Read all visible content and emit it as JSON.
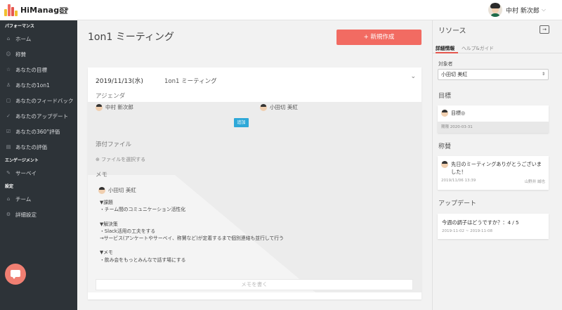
{
  "app": {
    "logo_text": "HiManager"
  },
  "user": {
    "name": "中村 新次郎"
  },
  "sidebar": {
    "sections": [
      {
        "title": "パフォーマンス",
        "items": [
          {
            "label": "ホーム",
            "icon": "home-icon"
          },
          {
            "label": "称賛",
            "icon": "smile-icon"
          },
          {
            "label": "あなたの目標",
            "icon": "star-icon"
          },
          {
            "label": "あなたの1on1",
            "icon": "person-icon"
          },
          {
            "label": "あなたのフィードバック",
            "icon": "chat-icon"
          },
          {
            "label": "あなたのアップデート",
            "icon": "check-icon"
          },
          {
            "label": "あなたの360°評価",
            "icon": "checkbox-icon"
          },
          {
            "label": "あなたの評価",
            "icon": "chart-icon"
          }
        ]
      },
      {
        "title": "エンゲージメント",
        "items": [
          {
            "label": "サーベイ",
            "icon": "edit-icon"
          }
        ]
      },
      {
        "title": "設定",
        "items": [
          {
            "label": "チーム",
            "icon": "home-icon"
          },
          {
            "label": "詳細設定",
            "icon": "gear-icon"
          }
        ]
      }
    ]
  },
  "main": {
    "title": "1on1 ミーティング",
    "new_button": "+ 新規作成",
    "meeting": {
      "date": "2019/11/13(水)",
      "name": "1on1 ミーティング",
      "agenda_label": "アジェンダ",
      "participant_a": "中村 新次郎",
      "participant_b": "小田切 美紅",
      "add_button": "追加",
      "attachments_label": "添付ファイル",
      "file_select": "ファイルを選択する",
      "memo_label": "メモ",
      "memo_author": "小田切 美紅",
      "memo_body": "▼課題\n・チーム間のコミュニケーション活性化\n\n▼解決策\n・Slack活用の工夫をする\n→サービス(アンケートやサーベイ、称賛など)が定着するまで個別連絡も並行して行う\n\n▼メモ\n・飲み会をもっとみんなで話す場にする",
      "memo_placeholder": "メモを書く"
    }
  },
  "panel": {
    "title": "リソース",
    "tabs": [
      "詳細情報",
      "ヘルプ&ガイド"
    ],
    "target_label": "対象者",
    "target_value": "小田切 美紅",
    "goal_section": "目標",
    "goal_title": "目標◎",
    "goal_due": "期限 2020-03-31",
    "praise_section": "称賛",
    "praise_text": "先日のミーティングありがとうございました！",
    "praise_date": "2019/11/06 13:39",
    "praise_by": "山野井 誠也",
    "update_section": "アップデート",
    "update_text": "今週の調子はどうですか？：4 / 5",
    "update_range": "2019-11-02 ~ 2019-11-08"
  },
  "colors": {
    "accent": "#f26b62",
    "sidebar": "#2d3338",
    "add_button": "#2ea8d8"
  }
}
